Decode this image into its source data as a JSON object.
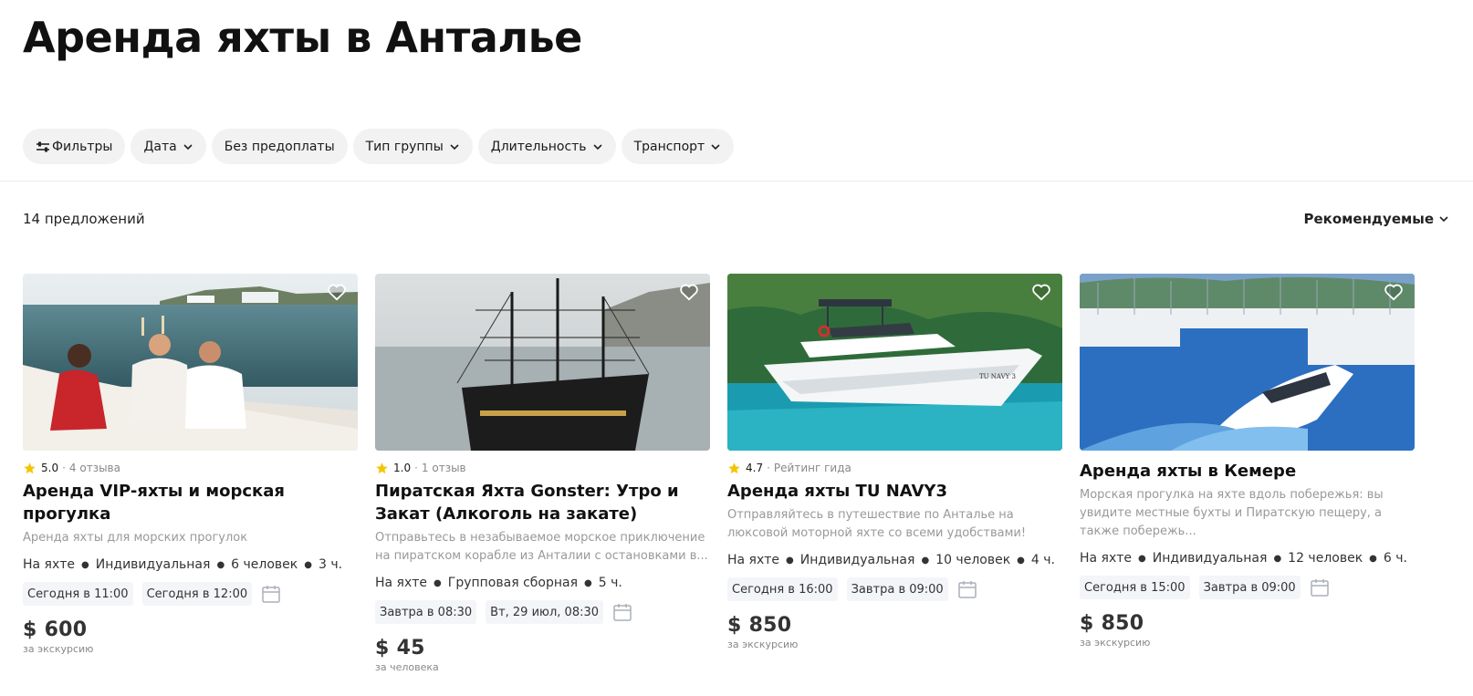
{
  "page": {
    "title": "Аренда яхты в Анталье"
  },
  "filters": [
    {
      "label": "Фильтры",
      "icon": "sliders-icon"
    },
    {
      "label": "Дата",
      "icon": "chevron-down-icon"
    },
    {
      "label": "Без предоплаты"
    },
    {
      "label": "Тип группы",
      "icon": "chevron-down-icon"
    },
    {
      "label": "Длительность",
      "icon": "chevron-down-icon"
    },
    {
      "label": "Транспорт",
      "icon": "chevron-down-icon"
    }
  ],
  "results": {
    "count": "14 предложений",
    "sort": "Рекомендуемые"
  },
  "cards": [
    {
      "rating": "5.0",
      "reviews": "4 отзыва",
      "title": "Аренда VIP-яхты и морская прогулка",
      "desc": "Аренда яхты для морских прогулок",
      "meta": [
        "На яхте",
        "Индивидуальная",
        "6 человек",
        "3 ч."
      ],
      "slots": [
        "Сегодня в 11:00",
        "Сегодня в 12:00"
      ],
      "price": "$ 600",
      "price_unit": "за экскурсию"
    },
    {
      "rating": "1.0",
      "reviews": "1 отзыв",
      "title": "Пиратская Яхта Gonster: Утро и Закат (Алкоголь на закате)",
      "desc": "Отправьтесь в незабываемое морское приключение на пиратском корабле из Анталии с остановками в...",
      "meta": [
        "На яхте",
        "Групповая сборная",
        "5 ч."
      ],
      "slots": [
        "Завтра в 08:30",
        "Вт, 29 июл, 08:30"
      ],
      "price": "$ 45",
      "price_unit": "за человека"
    },
    {
      "rating": "4.7",
      "reviews": "Рейтинг гида",
      "title": "Аренда яхты TU NAVY3",
      "desc": "Отправляйтесь в путешествие по Анталье на люксовой моторной яхте со всеми удобствами!",
      "meta": [
        "На яхте",
        "Индивидуальная",
        "10 человек",
        "4 ч."
      ],
      "slots": [
        "Сегодня в 16:00",
        "Завтра в 09:00"
      ],
      "price": "$ 850",
      "price_unit": "за экскурсию"
    },
    {
      "title": "Аренда яхты в Кемере",
      "desc": "Морская прогулка на яхте вдоль побережья: вы увидите местные бухты и Пиратскую пещеру, а также побережь...",
      "meta": [
        "На яхте",
        "Индивидуальная",
        "12 человек",
        "6 ч."
      ],
      "slots": [
        "Сегодня в 15:00",
        "Завтра в 09:00"
      ],
      "price": "$ 850",
      "price_unit": "за экскурсию"
    }
  ],
  "colors": {
    "star": "#f5c400",
    "chip_bg": "#f2f2f2",
    "slot_bg": "#f3f5f8"
  }
}
